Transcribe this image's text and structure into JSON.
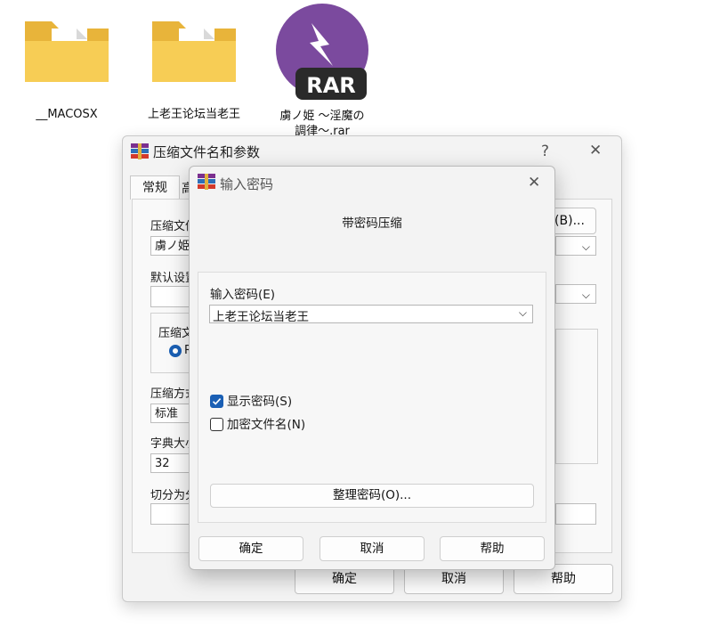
{
  "desktop": {
    "icons": [
      {
        "label": "__MACOSX",
        "kind": "folder-icon"
      },
      {
        "label": "上老王论坛当老王",
        "kind": "folder-icon"
      },
      {
        "label": "虜ノ姫 〜淫魔の調律〜.rar",
        "kind": "rar-icon",
        "badge": "RAR"
      }
    ]
  },
  "back_dialog": {
    "title": "压缩文件名和参数",
    "help_glyph": "?",
    "close_glyph": "✕",
    "tabs": [
      "常规",
      "高"
    ],
    "archive_name_label": "压缩文件",
    "archive_name_value": "虜ノ姫",
    "browse_button": "(B)...",
    "default_settings_label": "默认设置",
    "format_group_label": "压缩文",
    "format_radio_label": "R",
    "method_label": "压缩方式",
    "method_value": "标准",
    "dict_label": "字典大小",
    "dict_value": "32",
    "split_label": "切分为分",
    "ok": "确定",
    "cancel": "取消",
    "help": "帮助"
  },
  "front_dialog": {
    "title": "输入密码",
    "close_glyph": "✕",
    "heading": "带密码压缩",
    "password_label": "输入密码(E)",
    "password_value": "上老王论坛当老王",
    "show_password": {
      "label": "显示密码(S)",
      "checked": true
    },
    "encrypt_names": {
      "label": "加密文件名(N)",
      "checked": false
    },
    "organize_button": "整理密码(O)...",
    "ok": "确定",
    "cancel": "取消",
    "help": "帮助"
  },
  "colors": {
    "accent": "#1a5fb4",
    "rar_purple": "#7b4a9e",
    "folder_yellow": "#f5c84c"
  }
}
